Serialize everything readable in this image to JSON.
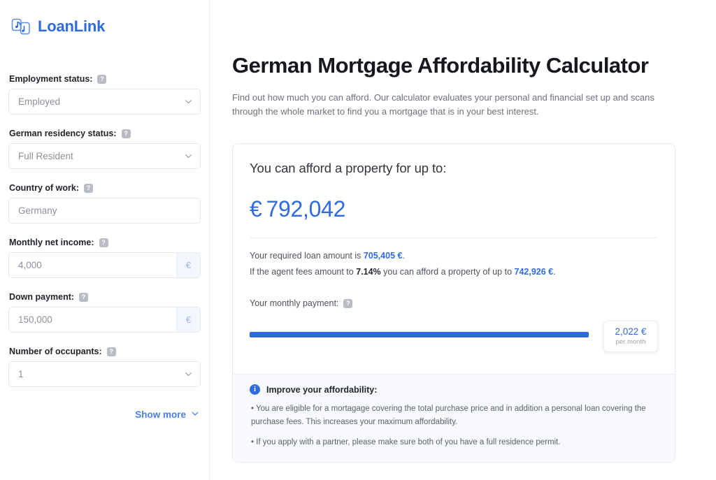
{
  "brand": {
    "name": "LoanLink",
    "logo_icon": "loanlink-logo-icon",
    "color": "#2f6bdc"
  },
  "sidebar": {
    "fields": [
      {
        "label": "Employment status:",
        "help_icon": "help-icon",
        "type": "select",
        "value": "Employed",
        "chevron_icon": "chevron-down-icon"
      },
      {
        "label": "German residency status:",
        "help_icon": "help-icon",
        "type": "select",
        "value": "Full Resident",
        "chevron_icon": "chevron-down-icon"
      },
      {
        "label": "Country of work:",
        "help_icon": "help-icon",
        "type": "text",
        "value": "Germany"
      },
      {
        "label": "Monthly net income:",
        "help_icon": "help-icon",
        "type": "currency",
        "value": "4,000",
        "suffix": "€"
      },
      {
        "label": "Down payment:",
        "help_icon": "help-icon",
        "type": "currency",
        "value": "150,000",
        "suffix": "€"
      },
      {
        "label": "Number of occupants:",
        "help_icon": "help-icon",
        "type": "select",
        "value": "1",
        "chevron_icon": "chevron-down-icon"
      }
    ],
    "show_more_label": "Show more",
    "show_more_icon": "chevron-down-icon"
  },
  "main": {
    "title": "German Mortgage Affordability Calculator",
    "subtitle": "Find out how much you can afford. Our calculator evaluates your personal and financial set up and scans through the whole market to find you a mortgage that is in your best interest.",
    "result": {
      "heading": "You can afford a property for up to:",
      "currency_symbol": "€",
      "amount": "792,042",
      "loan_line_prefix": "Your required loan amount is ",
      "loan_amount": "705,405 €",
      "loan_line_suffix": ".",
      "fees_line_prefix": "If the agent fees amount to ",
      "fees_percent": "7.14%",
      "fees_line_middle": " you can afford a property of up to ",
      "fees_amount": "742,926 €",
      "fees_line_suffix": ".",
      "payment_label": "Your monthly payment:",
      "payment_help_icon": "help-icon",
      "tooltip_amount": "2,022 €",
      "tooltip_sub": "per month",
      "bar_fill_percent": 83,
      "bar_color": "#2f6bdc"
    },
    "footer": {
      "info_icon": "info-icon",
      "heading": "Improve your affordability:",
      "tips": [
        "• You are eligible for a mortagage covering the total purchase price and in addition a personal loan covering the purchase fees. This increases your maximum affordability.",
        "• If you apply with a partner, please make sure both of you have a full residence permit."
      ]
    }
  }
}
